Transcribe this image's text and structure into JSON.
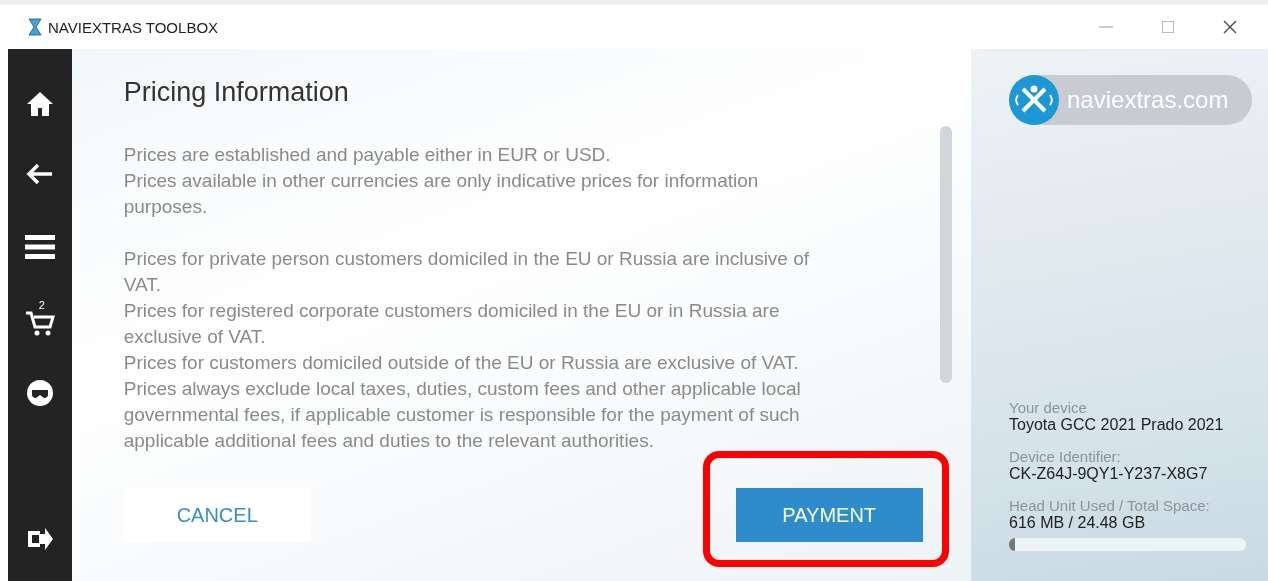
{
  "window": {
    "title": "NAVIEXTRAS TOOLBOX"
  },
  "sidebar": {
    "cart_count": "2"
  },
  "pricing": {
    "title": "Pricing Information",
    "paragraphs": [
      [
        "Prices are established and payable either in EUR or USD.",
        "Prices available in other currencies are only indicative prices for information purposes."
      ],
      [
        "Prices for private person customers domiciled in the EU or Russia are inclusive of VAT.",
        "Prices for registered corporate customers domiciled in the EU or in Russia are exclusive of VAT.",
        "Prices for customers domiciled outside of the EU or Russia are exclusive of VAT.",
        "Prices always exclude local taxes, duties, custom fees and other applicable local governmental fees, if applicable customer is responsible for the payment of such applicable additional fees and duties to the relevant authorities."
      ]
    ],
    "buttons": [
      {
        "label": "CANCEL",
        "kind": "secondary"
      },
      {
        "label": "PAYMENT",
        "kind": "primary",
        "highlighted": true
      }
    ]
  },
  "device": {
    "logo_text": "naviextras.com",
    "fields": [
      {
        "label": "Your device",
        "value": "Toyota GCC 2021 Prado 2021"
      },
      {
        "label": "Device Identifier:",
        "value": "CK-Z64J-9QY1-Y237-X8G7"
      },
      {
        "label": "Head Unit Used / Total Space:",
        "value": "616 MB / 24.48 GB"
      }
    ],
    "storage": {
      "level": 0.025
    }
  }
}
